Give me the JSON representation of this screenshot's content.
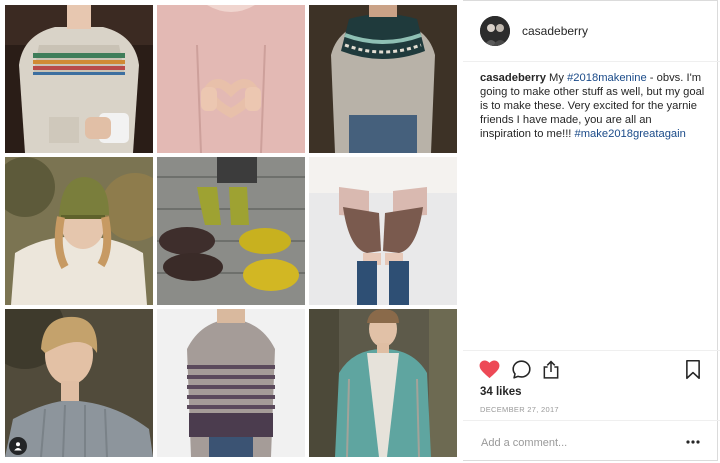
{
  "post": {
    "username": "casadeberry",
    "caption": {
      "username": "casadeberry",
      "text_1": " My ",
      "hashtag_1": "#2018makenine",
      "text_2": " - obvs. I'm going to make other stuff as well, but my goal is to make these. Very excited for the yarnie friends I have made, you are all an inspiration to me!!! ",
      "hashtag_2": "#make2018greatagain"
    },
    "likes": "34 likes",
    "date": "DECEMBER 27, 2017",
    "comment_placeholder": "Add a comment...",
    "liked": true
  },
  "colors": {
    "heart": "#ed4956",
    "hashtag": "#1b4b89",
    "muted": "#999999",
    "border": "#dbdbdb"
  },
  "icons": [
    "heart-icon",
    "comment-icon",
    "share-icon",
    "bookmark-icon",
    "more-options-icon",
    "tagged-user-icon"
  ],
  "grid": {
    "tiles": [
      {
        "subject": "cream fair-isle yoke sweater with mug"
      },
      {
        "subject": "pink sweater with hands making a heart"
      },
      {
        "subject": "grey sweater with teal and dark yoke"
      },
      {
        "subject": "woman in green cabled hat"
      },
      {
        "subject": "mustard knitted slippers on wood deck"
      },
      {
        "subject": "brown fingerless mitts in snow"
      },
      {
        "subject": "woman in grey ribbed sweater"
      },
      {
        "subject": "striped grey and purple sweater"
      },
      {
        "subject": "woman in teal and grey cardigan"
      }
    ]
  }
}
